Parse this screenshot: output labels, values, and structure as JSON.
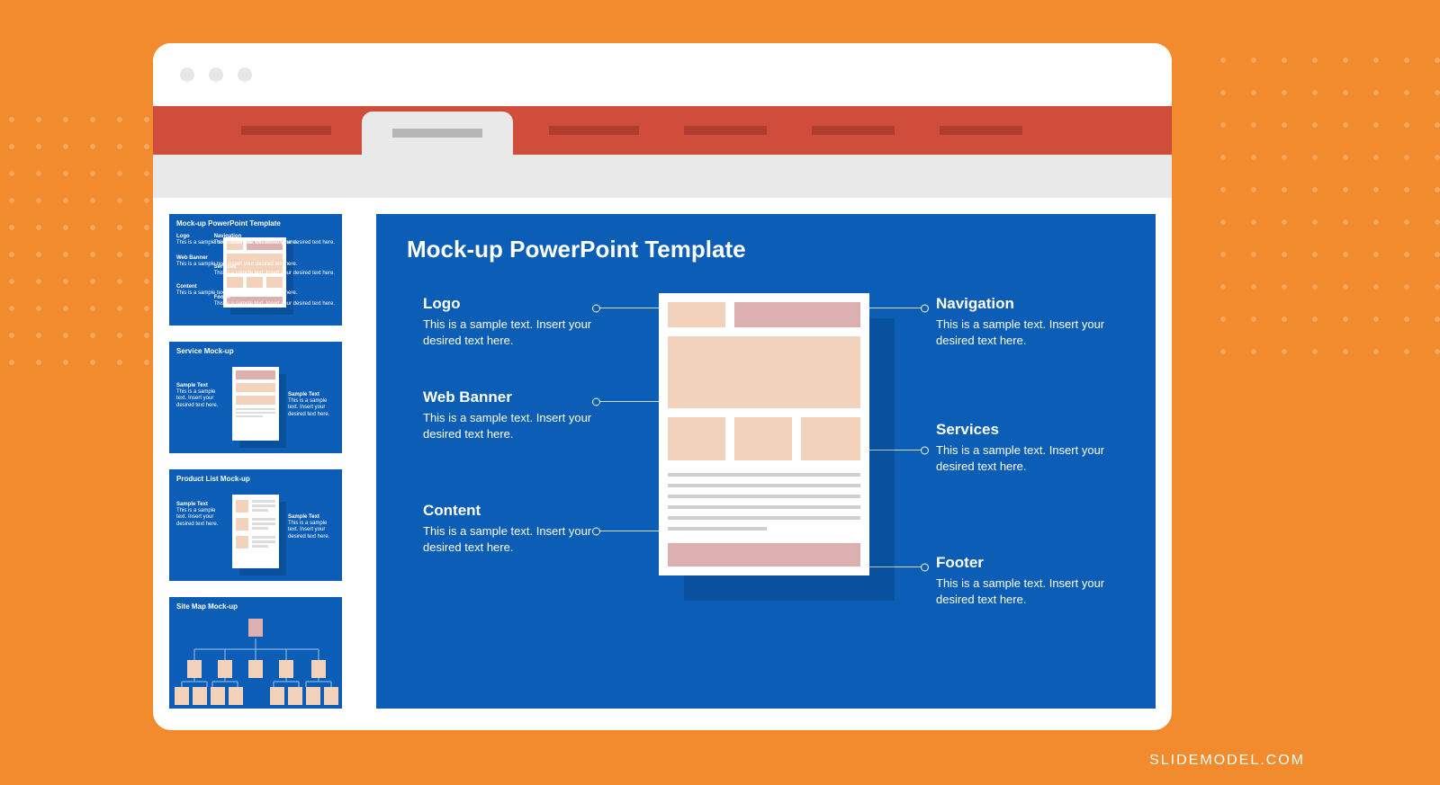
{
  "attribution": "SLIDEMODEL.COM",
  "slide": {
    "title": "Mock-up PowerPoint Template",
    "sample_text": "This is a sample text. Insert your desired text here.",
    "annotations": {
      "left": [
        {
          "label": "Logo"
        },
        {
          "label": "Web Banner"
        },
        {
          "label": "Content"
        }
      ],
      "right": [
        {
          "label": "Navigation"
        },
        {
          "label": "Services"
        },
        {
          "label": "Footer"
        }
      ]
    }
  },
  "thumbnails": [
    {
      "title": "Mock-up PowerPoint Template",
      "labels_left": [
        "Logo",
        "Web Banner",
        "Content"
      ],
      "labels_right": [
        "Navigation",
        "Services",
        "Footer"
      ],
      "mini_desc": "This is a sample text. Insert your desired text here."
    },
    {
      "title": "Service Mock-up",
      "label_a": "Sample Text",
      "label_b": "Sample Text",
      "mini_desc": "This is a sample text. Insert your desired text here."
    },
    {
      "title": "Product List Mock-up",
      "label_a": "Sample Text",
      "label_b": "Sample Text",
      "mini_desc": "This is a sample text. Insert your desired text here."
    },
    {
      "title": "Site Map Mock-up"
    }
  ]
}
